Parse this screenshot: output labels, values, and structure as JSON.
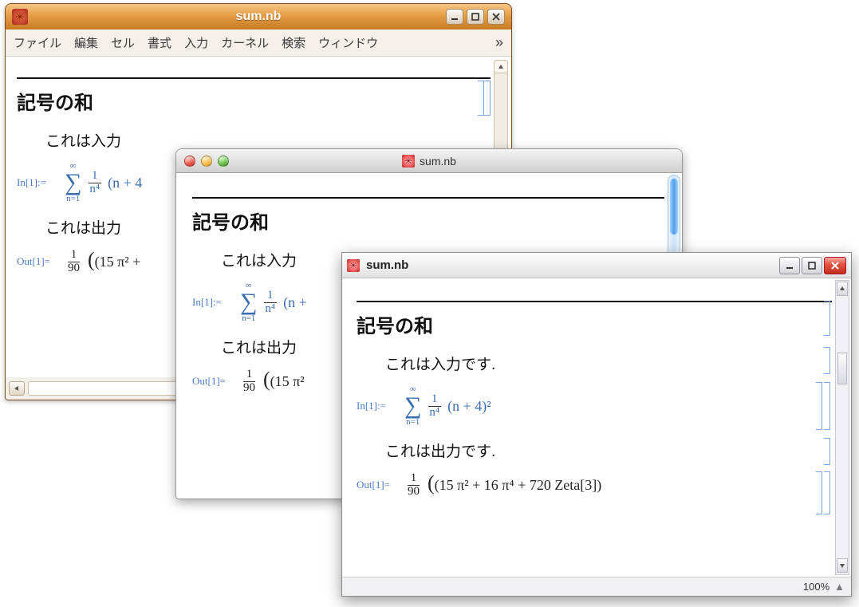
{
  "window1": {
    "title": "sum.nb",
    "menu": [
      "ファイル",
      "編集",
      "セル",
      "書式",
      "入力",
      "カーネル",
      "検索",
      "ウィンドウ"
    ],
    "overflow_glyph": "»",
    "section_title": "記号の和",
    "input_text": "これは入力",
    "output_text": "これは出力",
    "in_label": "In[1]:=",
    "out_label": "Out[1]=",
    "sum_top": "∞",
    "sum_bottom": "n=1",
    "frac_num": "1",
    "frac_den": "n⁴",
    "in_tail": "(n + 4",
    "out_frac_num": "1",
    "out_frac_den": "90",
    "out_tail": "(15 π² +"
  },
  "window2": {
    "title": "sum.nb",
    "section_title": "記号の和",
    "input_text": "これは入力",
    "output_text": "これは出力",
    "in_label": "In[1]:=",
    "out_label": "Out[1]=",
    "sum_top": "∞",
    "sum_bottom": "n=1",
    "frac_num": "1",
    "frac_den": "n⁴",
    "in_tail": "(n +",
    "out_frac_num": "1",
    "out_frac_den": "90",
    "out_tail": "(15 π²"
  },
  "window3": {
    "title": "sum.nb",
    "section_title": "記号の和",
    "input_text": "これは入力です.",
    "output_text": "これは出力です.",
    "in_label": "In[1]:=",
    "out_label": "Out[1]=",
    "sum_top": "∞",
    "sum_bottom": "n=1",
    "frac_num": "1",
    "frac_den": "n⁴",
    "in_expr": "(n + 4)²",
    "out_frac_num": "1",
    "out_frac_den": "90",
    "out_expr": "(15 π² + 16 π⁴ + 720 Zeta[3])",
    "zoom": "100%"
  }
}
